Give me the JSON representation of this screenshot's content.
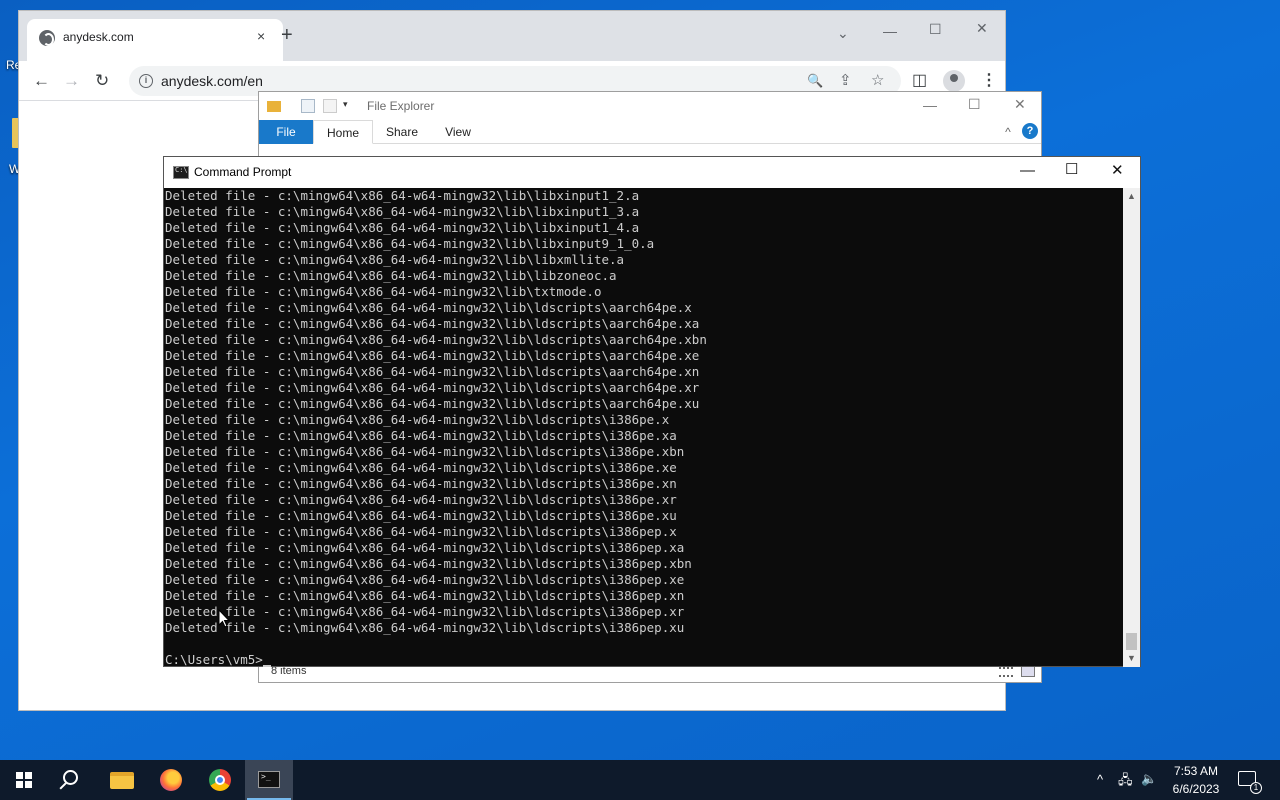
{
  "desktop": {
    "label_top": "Re",
    "label_mid": "W"
  },
  "chrome": {
    "tab_title": "anydesk.com",
    "tab_close": "×",
    "new_tab": "+",
    "url": "anydesk.com/en",
    "info_glyph": "i",
    "controls": {
      "dropdown": "⌄",
      "minimize": "—",
      "maximize": "☐",
      "close": "✕"
    },
    "nav": {
      "back": "←",
      "forward": "→",
      "reload": "↻"
    },
    "omni_icons": {
      "search": "🔍",
      "share": "⇪",
      "star": "☆"
    },
    "toolbar_icons": {
      "side_panel": "◫",
      "menu": "⋮"
    }
  },
  "explorer": {
    "title": "File Explorer",
    "tabs": {
      "file": "File",
      "home": "Home",
      "share": "Share",
      "view": "View"
    },
    "help": "?",
    "caret": "^",
    "status": "8 items",
    "controls": {
      "minimize": "—",
      "maximize": "☐",
      "close": "✕"
    }
  },
  "cmd": {
    "title": "Command Prompt",
    "controls": {
      "minimize": "—",
      "maximize": "☐",
      "close": "✕"
    },
    "scroll_up": "▲",
    "scroll_down": "▼",
    "lines": [
      "Deleted file - c:\\mingw64\\x86_64-w64-mingw32\\lib\\libxinput1_2.a",
      "Deleted file - c:\\mingw64\\x86_64-w64-mingw32\\lib\\libxinput1_3.a",
      "Deleted file - c:\\mingw64\\x86_64-w64-mingw32\\lib\\libxinput1_4.a",
      "Deleted file - c:\\mingw64\\x86_64-w64-mingw32\\lib\\libxinput9_1_0.a",
      "Deleted file - c:\\mingw64\\x86_64-w64-mingw32\\lib\\libxmllite.a",
      "Deleted file - c:\\mingw64\\x86_64-w64-mingw32\\lib\\libzoneoc.a",
      "Deleted file - c:\\mingw64\\x86_64-w64-mingw32\\lib\\txtmode.o",
      "Deleted file - c:\\mingw64\\x86_64-w64-mingw32\\lib\\ldscripts\\aarch64pe.x",
      "Deleted file - c:\\mingw64\\x86_64-w64-mingw32\\lib\\ldscripts\\aarch64pe.xa",
      "Deleted file - c:\\mingw64\\x86_64-w64-mingw32\\lib\\ldscripts\\aarch64pe.xbn",
      "Deleted file - c:\\mingw64\\x86_64-w64-mingw32\\lib\\ldscripts\\aarch64pe.xe",
      "Deleted file - c:\\mingw64\\x86_64-w64-mingw32\\lib\\ldscripts\\aarch64pe.xn",
      "Deleted file - c:\\mingw64\\x86_64-w64-mingw32\\lib\\ldscripts\\aarch64pe.xr",
      "Deleted file - c:\\mingw64\\x86_64-w64-mingw32\\lib\\ldscripts\\aarch64pe.xu",
      "Deleted file - c:\\mingw64\\x86_64-w64-mingw32\\lib\\ldscripts\\i386pe.x",
      "Deleted file - c:\\mingw64\\x86_64-w64-mingw32\\lib\\ldscripts\\i386pe.xa",
      "Deleted file - c:\\mingw64\\x86_64-w64-mingw32\\lib\\ldscripts\\i386pe.xbn",
      "Deleted file - c:\\mingw64\\x86_64-w64-mingw32\\lib\\ldscripts\\i386pe.xe",
      "Deleted file - c:\\mingw64\\x86_64-w64-mingw32\\lib\\ldscripts\\i386pe.xn",
      "Deleted file - c:\\mingw64\\x86_64-w64-mingw32\\lib\\ldscripts\\i386pe.xr",
      "Deleted file - c:\\mingw64\\x86_64-w64-mingw32\\lib\\ldscripts\\i386pe.xu",
      "Deleted file - c:\\mingw64\\x86_64-w64-mingw32\\lib\\ldscripts\\i386pep.x",
      "Deleted file - c:\\mingw64\\x86_64-w64-mingw32\\lib\\ldscripts\\i386pep.xa",
      "Deleted file - c:\\mingw64\\x86_64-w64-mingw32\\lib\\ldscripts\\i386pep.xbn",
      "Deleted file - c:\\mingw64\\x86_64-w64-mingw32\\lib\\ldscripts\\i386pep.xe",
      "Deleted file - c:\\mingw64\\x86_64-w64-mingw32\\lib\\ldscripts\\i386pep.xn",
      "Deleted file - c:\\mingw64\\x86_64-w64-mingw32\\lib\\ldscripts\\i386pep.xr",
      "Deleted file - c:\\mingw64\\x86_64-w64-mingw32\\lib\\ldscripts\\i386pep.xu",
      ""
    ],
    "prompt": "C:\\Users\\vm5>"
  },
  "taskbar": {
    "apps": [
      "start",
      "search",
      "file-explorer",
      "firefox",
      "chrome",
      "command-prompt"
    ],
    "active_app": "command-prompt",
    "tray": {
      "chevron": "^",
      "network": "🖧",
      "volume": "🔈",
      "notifications": "1"
    },
    "time": "7:53 AM",
    "date": "6/6/2023"
  },
  "colors": {
    "desktop": "#0a63c8",
    "taskbar": "#0e1a2b",
    "cmd_bg": "#0c0c0c",
    "cmd_text": "#cccccc",
    "ribbon_file": "#1979ca"
  }
}
